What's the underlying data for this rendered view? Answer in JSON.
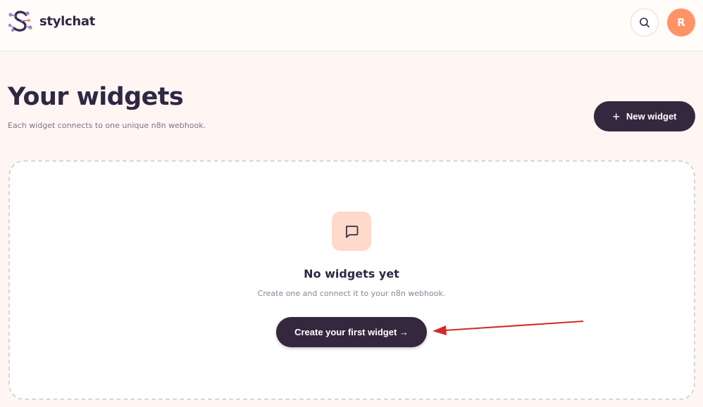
{
  "brand": {
    "name": "stylchat"
  },
  "header": {
    "search_icon": "search-icon",
    "avatar_initial": "R"
  },
  "page": {
    "title": "Your widgets",
    "subtitle": "Each widget connects to one unique n8n webhook.",
    "new_widget_label": "New widget"
  },
  "empty_state": {
    "icon": "chat-bubble-icon",
    "title": "No widgets yet",
    "description": "Create one and connect it to your n8n webhook.",
    "cta_label": "Create your first widget →"
  },
  "colors": {
    "background": "#fff6f3",
    "brand_dark": "#34283f",
    "avatar": "#ff9368",
    "icon_tile": "#ffd9c9",
    "annotation_arrow": "#d42a2a"
  }
}
